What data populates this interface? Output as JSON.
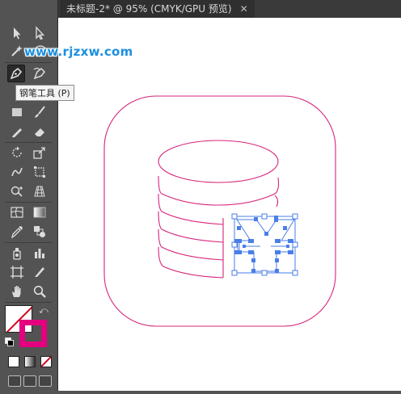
{
  "document_tab": {
    "title": "未标题-2* @ 95% (CMYK/GPU 预览)",
    "close_glyph": "✕"
  },
  "tooltip": {
    "text": "钢笔工具 (P)"
  },
  "watermark": {
    "text": "www.rjzxw.com"
  },
  "toolbar": {
    "tools": [
      {
        "name": "selection-tool",
        "icon": "selection-arrow-icon"
      },
      {
        "name": "direct-selection-tool",
        "icon": "direct-selection-arrow-icon"
      },
      {
        "name": "magic-wand-tool",
        "icon": "magic-wand-icon"
      },
      {
        "name": "lasso-tool",
        "icon": "lasso-icon"
      },
      {
        "name": "pen-tool",
        "icon": "pen-icon",
        "active": true
      },
      {
        "name": "curvature-tool",
        "icon": "curvature-pen-icon"
      },
      {
        "name": "type-tool",
        "icon": "type-icon"
      },
      {
        "name": "line-segment-tool",
        "icon": "line-icon"
      },
      {
        "name": "rectangle-tool",
        "icon": "rectangle-icon"
      },
      {
        "name": "paintbrush-tool",
        "icon": "paintbrush-icon"
      },
      {
        "name": "pencil-tool",
        "icon": "pencil-icon"
      },
      {
        "name": "eraser-tool",
        "icon": "eraser-icon"
      },
      {
        "name": "rotate-tool",
        "icon": "rotate-icon"
      },
      {
        "name": "scale-tool",
        "icon": "scale-icon"
      },
      {
        "name": "warp-tool",
        "icon": "warp-icon"
      },
      {
        "name": "free-transform-tool",
        "icon": "free-transform-icon"
      },
      {
        "name": "shape-builder-tool",
        "icon": "shape-builder-icon"
      },
      {
        "name": "perspective-grid-tool",
        "icon": "perspective-grid-icon"
      },
      {
        "name": "mesh-tool",
        "icon": "mesh-icon"
      },
      {
        "name": "gradient-tool",
        "icon": "gradient-icon"
      },
      {
        "name": "eyedropper-tool",
        "icon": "eyedropper-icon"
      },
      {
        "name": "blend-tool",
        "icon": "blend-icon"
      },
      {
        "name": "symbol-sprayer-tool",
        "icon": "symbol-sprayer-icon"
      },
      {
        "name": "column-graph-tool",
        "icon": "column-graph-icon"
      },
      {
        "name": "artboard-tool",
        "icon": "artboard-icon"
      },
      {
        "name": "slice-tool",
        "icon": "slice-icon"
      },
      {
        "name": "hand-tool",
        "icon": "hand-icon"
      },
      {
        "name": "zoom-tool",
        "icon": "zoom-icon"
      }
    ],
    "colors": {
      "fill": "#ffffff",
      "stroke": "#e4007f",
      "none_slash": "#d4001a"
    }
  },
  "artwork": {
    "stroke_color": "#d6247a",
    "selection_color": "#4a7ee8"
  }
}
